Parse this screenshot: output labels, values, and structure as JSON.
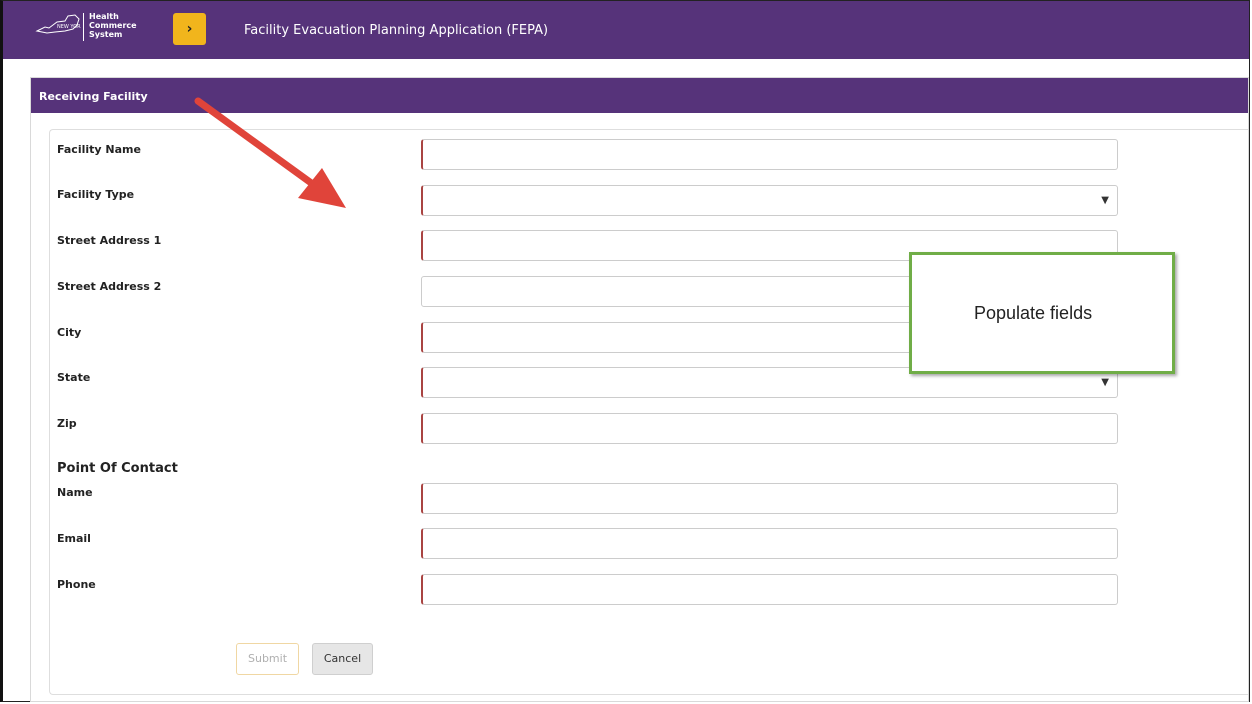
{
  "header": {
    "logo_lines": [
      "Health",
      "Commerce",
      "System"
    ],
    "menu_button_icon": "chevron-right-icon",
    "menu_button_glyph": "›",
    "app_title": "Facility Evacuation Planning Application (FEPA)",
    "bar_color": "#56337a",
    "menu_button_color": "#f1b51c"
  },
  "panel": {
    "title": "Receiving Facility"
  },
  "form": {
    "facility_name_label": "Facility Name",
    "facility_type_label": "Facility Type",
    "street1_label": "Street Address 1",
    "street2_label": "Street Address 2",
    "city_label": "City",
    "state_label": "State",
    "zip_label": "Zip",
    "contact_heading": "Point Of Contact",
    "name_label": "Name",
    "email_label": "Email",
    "phone_label": "Phone",
    "dropdown_glyph": "▼",
    "submit_label": "Submit",
    "cancel_label": "Cancel"
  },
  "annotation": {
    "callout_text": "Populate fields",
    "arrow_color": "#e0443a",
    "callout_border_color": "#70ad47"
  }
}
